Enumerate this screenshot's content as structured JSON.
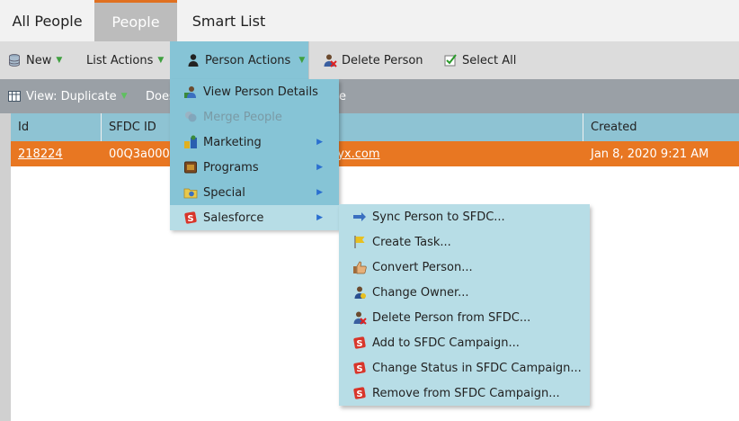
{
  "tabs": [
    {
      "label": "All People"
    },
    {
      "label": "People"
    },
    {
      "label": "Smart List"
    }
  ],
  "toolbar": {
    "new_label": "New",
    "list_actions_label": "List Actions",
    "person_actions_label": "Person Actions",
    "delete_person_label": "Delete Person",
    "select_all_label": "Select All"
  },
  "subbar": {
    "view_label": "View: Duplicate",
    "filter_partial": "Does",
    "trailing_partial": "e"
  },
  "grid": {
    "columns": [
      "Id",
      "SFDC ID",
      "Created"
    ],
    "row": {
      "id": "218224",
      "sfdc_id": "00Q3a0000",
      "email_partial": "nyx.com",
      "created": "Jan 8, 2020 9:21 AM"
    }
  },
  "menu": {
    "items": [
      {
        "label": "View Person Details",
        "icon": "person-details-icon"
      },
      {
        "label": "Merge People",
        "icon": "merge-icon"
      },
      {
        "label": "Marketing",
        "icon": "marketing-icon"
      },
      {
        "label": "Programs",
        "icon": "programs-icon"
      },
      {
        "label": "Special",
        "icon": "special-icon"
      },
      {
        "label": "Salesforce",
        "icon": "salesforce-icon"
      }
    ]
  },
  "submenu": {
    "items": [
      {
        "label": "Sync Person to SFDC...",
        "icon": "sync-arrow-icon"
      },
      {
        "label": "Create Task...",
        "icon": "flag-icon"
      },
      {
        "label": "Convert Person...",
        "icon": "thumbs-up-icon"
      },
      {
        "label": "Change Owner...",
        "icon": "change-owner-icon"
      },
      {
        "label": "Delete Person from SFDC...",
        "icon": "delete-person-icon"
      },
      {
        "label": "Add to SFDC Campaign...",
        "icon": "salesforce-icon"
      },
      {
        "label": "Change Status in SFDC Campaign...",
        "icon": "salesforce-icon"
      },
      {
        "label": "Remove from SFDC Campaign...",
        "icon": "salesforce-icon"
      }
    ]
  },
  "colors": {
    "accent_orange": "#e87722",
    "menu_blue": "#86c4d6",
    "submenu_blue": "#b7dde6"
  }
}
